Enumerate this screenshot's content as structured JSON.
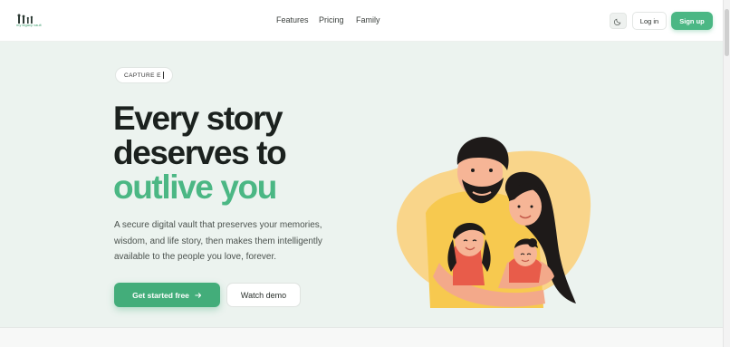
{
  "header": {
    "logo_text": "my legacy vault",
    "nav": [
      {
        "label": "Features"
      },
      {
        "label": "Pricing"
      },
      {
        "label": "Family"
      }
    ],
    "theme_icon": "moon-icon",
    "login_label": "Log in",
    "signup_label": "Sign up"
  },
  "hero": {
    "badge": "CAPTURE E",
    "headline_line1": "Every story",
    "headline_line2": "deserves to",
    "headline_accent": "outlive you",
    "subtext": "A secure digital vault that preserves your memories, wisdom, and life story, then makes them intelligently available to the people you love, forever.",
    "cta_primary": "Get started free",
    "cta_primary_icon": "arrow-right-icon",
    "cta_secondary": "Watch demo"
  },
  "colors": {
    "accent": "#4bb784",
    "hero_bg": "#ecf3ef",
    "blob": "#f9d58a"
  }
}
